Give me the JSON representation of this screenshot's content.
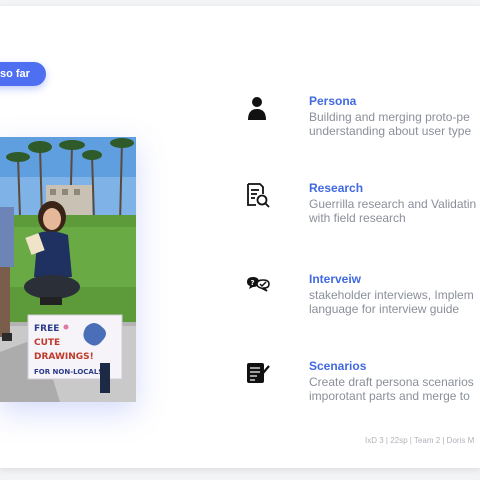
{
  "pill": {
    "label": "so far"
  },
  "photo": {
    "sign_line1": "FREE",
    "sign_line2": "CUTE",
    "sign_line3": "DRAWINGS!",
    "sign_line4": "FOR NON-LOCALS"
  },
  "items": [
    {
      "icon": "person-icon",
      "title": "Persona",
      "line1": "Building and merging proto-pe",
      "line2": "understanding about user type"
    },
    {
      "icon": "document-search-icon",
      "title": "Research",
      "line1": "Guerrilla research and Validatin",
      "line2": "with field research"
    },
    {
      "icon": "chat-bubbles-icon",
      "title": "Interveiw",
      "line1": "stakeholder interviews, Implem",
      "line2": "language for interview guide"
    },
    {
      "icon": "scroll-pen-icon",
      "title": "Scenarios",
      "line1": "Create draft persona scenarios",
      "line2": "imporotant parts and merge to"
    }
  ],
  "footer": {
    "text": "IxD 3 | 22sp | Team 2 | Doris M"
  }
}
